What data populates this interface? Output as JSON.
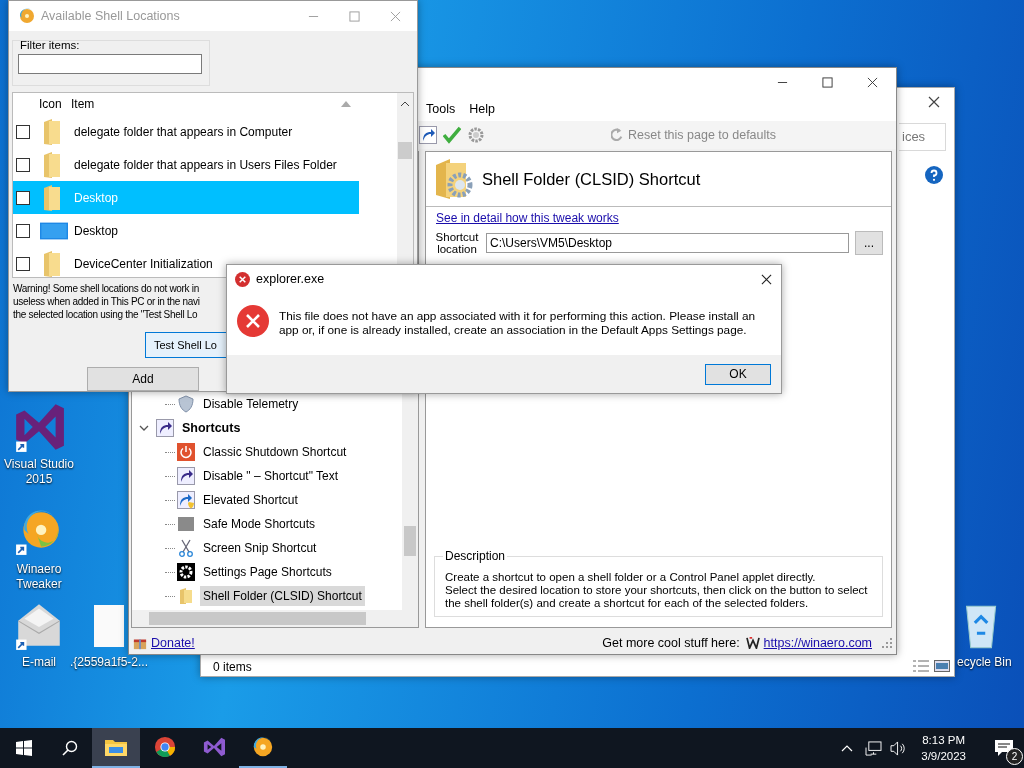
{
  "desktop_icons": [
    {
      "kind": "visual-studio",
      "label": "Visual Studio 2015"
    },
    {
      "kind": "winaero",
      "label": "Winaero Tweaker"
    },
    {
      "kind": "email",
      "label": "E-mail"
    },
    {
      "kind": "file",
      "label": ".{2559a1f5-2..."
    },
    {
      "kind": "recycle-bin",
      "label": "ecycle Bin"
    }
  ],
  "explorer_window": {
    "search": {
      "placeholder": "ices"
    },
    "status": "0 items"
  },
  "tweaker_window": {
    "menu": [
      "Tools",
      "Help"
    ],
    "toolbar": {
      "reset": {
        "label": "Reset this page to defaults",
        "disabled": true
      }
    },
    "tree": [
      {
        "kind": "shield",
        "label": "Disable Telemetry",
        "selected": false
      },
      {
        "kind": "shortcut",
        "label": "Shortcuts",
        "expanded": true,
        "children": [
          {
            "kind": "power",
            "label": "Classic Shutdown Shortcut",
            "selected": false
          },
          {
            "kind": "shortcut",
            "label": "Disable \" – Shortcut\" Text",
            "selected": false
          },
          {
            "kind": "shortcut-shield",
            "label": "Elevated Shortcut",
            "selected": false
          },
          {
            "kind": "square",
            "label": "Safe Mode Shortcuts",
            "selected": false
          },
          {
            "kind": "scissors",
            "label": "Screen Snip Shortcut",
            "selected": false
          },
          {
            "kind": "gear",
            "label": "Settings Page Shortcuts",
            "selected": false
          },
          {
            "kind": "folder",
            "label": "Shell Folder (CLSID) Shortcut",
            "selected": true
          }
        ]
      }
    ],
    "page": {
      "title": "Shell Folder (CLSID) Shortcut",
      "link": "See in detail how this tweak works",
      "location_label": "Shortcut location",
      "location_value": "C:\\Users\\VM5\\Desktop",
      "browse_button": "...",
      "description_title": "Description",
      "description": "Create a shortcut to open a shell folder or a Control Panel applet directly.\nSelect the desired location to store your shortcuts, then click on the button to select the shell folder(s) and create a shortcut for each of the selected folders."
    },
    "status": {
      "donate": "Donate!",
      "promo": "Get more cool stuff here:",
      "url": "https://winaero.com"
    }
  },
  "shell_locations_window": {
    "title": "Available Shell Locations",
    "filter": {
      "label": "Filter items:"
    },
    "columns": [
      "Icon",
      "Item"
    ],
    "rows": [
      {
        "kind": "folder",
        "label": "delegate folder that appears in Computer",
        "checked": false,
        "selected": false
      },
      {
        "kind": "folder",
        "label": "delegate folder that appears in Users Files Folder",
        "checked": false,
        "selected": false
      },
      {
        "kind": "folder",
        "label": "Desktop",
        "checked": false,
        "selected": true
      },
      {
        "kind": "desktop",
        "label": "Desktop",
        "checked": false,
        "selected": false
      },
      {
        "kind": "folder",
        "label": "DeviceCenter Initialization",
        "checked": false,
        "selected": false
      }
    ],
    "warning_lines": [
      "Warning! Some shell locations do not work in",
      "useless when added in This PC or in the navi",
      "the selected location using the \"Test Shell Lo"
    ],
    "buttons": [
      "Test Shell Lo",
      "Add"
    ]
  },
  "dialog": {
    "title": "explorer.exe",
    "message": "This file does not have an app associated with it for performing this action. Please install an app or, if one is already installed, create an association in the Default Apps Settings page.",
    "button": "OK"
  },
  "taskbar": {
    "apps": [
      {
        "kind": "explorer",
        "active": true,
        "running": true
      },
      {
        "kind": "chrome",
        "active": false,
        "running": false
      },
      {
        "kind": "visual-studio",
        "active": false,
        "running": false
      },
      {
        "kind": "winaero",
        "active": false,
        "running": true
      }
    ],
    "time": "8:13 PM",
    "date": "3/9/2023",
    "notifications": "2"
  }
}
